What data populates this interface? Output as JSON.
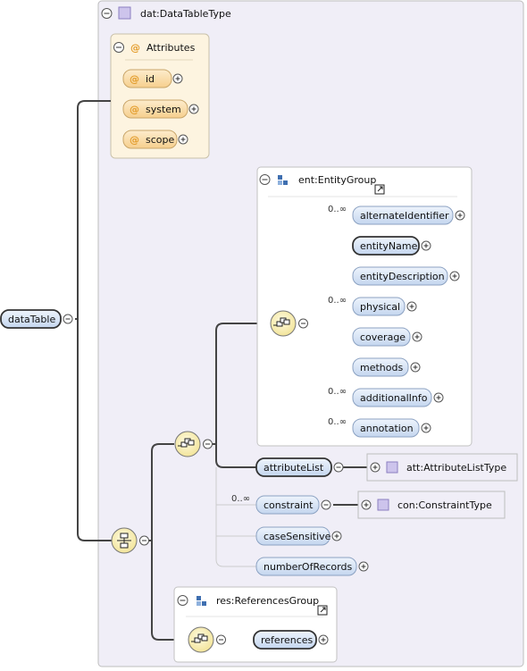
{
  "complex_type": {
    "label": "dat:DataTableType"
  },
  "attributes": {
    "title": "Attributes",
    "items": [
      {
        "label": "id"
      },
      {
        "label": "system"
      },
      {
        "label": "scope"
      }
    ]
  },
  "root_element": {
    "label": "dataTable"
  },
  "entity_group": {
    "label": "ent:EntityGroup",
    "elements": [
      {
        "label": "alternateIdentifier",
        "cardinality": "0..∞"
      },
      {
        "label": "entityName",
        "cardinality": ""
      },
      {
        "label": "entityDescription",
        "cardinality": ""
      },
      {
        "label": "physical",
        "cardinality": "0..∞"
      },
      {
        "label": "coverage",
        "cardinality": ""
      },
      {
        "label": "methods",
        "cardinality": ""
      },
      {
        "label": "additionalInfo",
        "cardinality": "0..∞"
      },
      {
        "label": "annotation",
        "cardinality": "0..∞"
      }
    ]
  },
  "sequence_elements": [
    {
      "label": "attributeList",
      "cardinality": "",
      "type": "att:AttributeListType"
    },
    {
      "label": "constraint",
      "cardinality": "0..∞",
      "type": "con:ConstraintType"
    },
    {
      "label": "caseSensitive",
      "cardinality": ""
    },
    {
      "label": "numberOfRecords",
      "cardinality": ""
    }
  ],
  "references_group": {
    "label": "res:ReferencesGroup",
    "elements": [
      {
        "label": "references"
      }
    ]
  },
  "colors": {
    "panel_bg": "#f0eef7",
    "attributes_bg": "#fdf4e0",
    "attribute_fill": "#fbd9a0",
    "element_fill": "#d5e3f5",
    "compositor_fill": "#fdf3bf",
    "connector": "#444444"
  }
}
